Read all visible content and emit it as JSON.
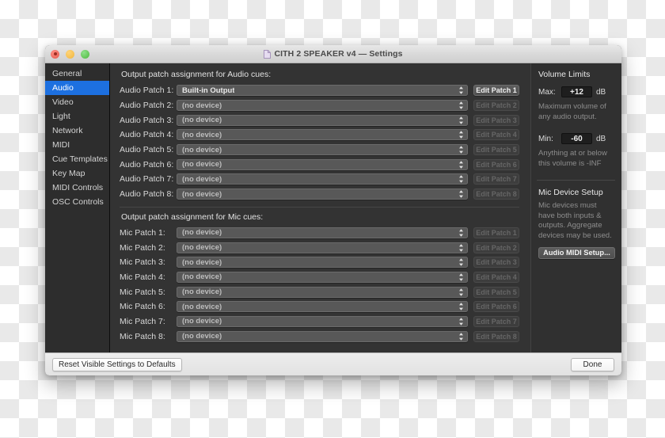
{
  "window": {
    "title": "CITH 2 SPEAKER v4 — Settings",
    "doc_icon": "document-icon",
    "traffic_lights": {
      "close": "close-button",
      "minimize": "minimize-button",
      "zoom": "zoom-button"
    }
  },
  "sidebar": {
    "items": [
      {
        "label": "General",
        "selected": false
      },
      {
        "label": "Audio",
        "selected": true
      },
      {
        "label": "Video",
        "selected": false
      },
      {
        "label": "Light",
        "selected": false
      },
      {
        "label": "Network",
        "selected": false
      },
      {
        "label": "MIDI",
        "selected": false
      },
      {
        "label": "Cue Templates",
        "selected": false
      },
      {
        "label": "Key Map",
        "selected": false
      },
      {
        "label": "MIDI Controls",
        "selected": false
      },
      {
        "label": "OSC Controls",
        "selected": false
      }
    ],
    "selected_color": "#1d70e0"
  },
  "audio_section": {
    "heading": "Output patch assignment for Audio cues:",
    "rows": [
      {
        "label": "Audio Patch 1:",
        "device": "Built-in Output",
        "edit_label": "Edit Patch 1",
        "enabled": true
      },
      {
        "label": "Audio Patch 2:",
        "device": "(no device)",
        "edit_label": "Edit Patch 2",
        "enabled": false
      },
      {
        "label": "Audio Patch 3:",
        "device": "(no device)",
        "edit_label": "Edit Patch 3",
        "enabled": false
      },
      {
        "label": "Audio Patch 4:",
        "device": "(no device)",
        "edit_label": "Edit Patch 4",
        "enabled": false
      },
      {
        "label": "Audio Patch 5:",
        "device": "(no device)",
        "edit_label": "Edit Patch 5",
        "enabled": false
      },
      {
        "label": "Audio Patch 6:",
        "device": "(no device)",
        "edit_label": "Edit Patch 6",
        "enabled": false
      },
      {
        "label": "Audio Patch 7:",
        "device": "(no device)",
        "edit_label": "Edit Patch 7",
        "enabled": false
      },
      {
        "label": "Audio Patch 8:",
        "device": "(no device)",
        "edit_label": "Edit Patch 8",
        "enabled": false
      }
    ]
  },
  "mic_section": {
    "heading": "Output patch assignment for Mic cues:",
    "rows": [
      {
        "label": "Mic Patch 1:",
        "device": "(no device)",
        "edit_label": "Edit Patch 1",
        "enabled": false
      },
      {
        "label": "Mic Patch 2:",
        "device": "(no device)",
        "edit_label": "Edit Patch 2",
        "enabled": false
      },
      {
        "label": "Mic Patch 3:",
        "device": "(no device)",
        "edit_label": "Edit Patch 3",
        "enabled": false
      },
      {
        "label": "Mic Patch 4:",
        "device": "(no device)",
        "edit_label": "Edit Patch 4",
        "enabled": false
      },
      {
        "label": "Mic Patch 5:",
        "device": "(no device)",
        "edit_label": "Edit Patch 5",
        "enabled": false
      },
      {
        "label": "Mic Patch 6:",
        "device": "(no device)",
        "edit_label": "Edit Patch 6",
        "enabled": false
      },
      {
        "label": "Mic Patch 7:",
        "device": "(no device)",
        "edit_label": "Edit Patch 7",
        "enabled": false
      },
      {
        "label": "Mic Patch 8:",
        "device": "(no device)",
        "edit_label": "Edit Patch 8",
        "enabled": false
      }
    ]
  },
  "volume_limits": {
    "title": "Volume Limits",
    "max_label": "Max:",
    "max_value": "+12",
    "max_unit": "dB",
    "max_help": "Maximum volume of any audio output.",
    "min_label": "Min:",
    "min_value": "-60",
    "min_unit": "dB",
    "min_help": "Anything at or below this volume is -INF"
  },
  "mic_device_setup": {
    "title": "Mic Device Setup",
    "help": "Mic devices must have both inputs & outputs. Aggregate devices may be used.",
    "button_label": "Audio MIDI Setup..."
  },
  "footer": {
    "reset_label": "Reset Visible Settings to Defaults",
    "done_label": "Done"
  }
}
